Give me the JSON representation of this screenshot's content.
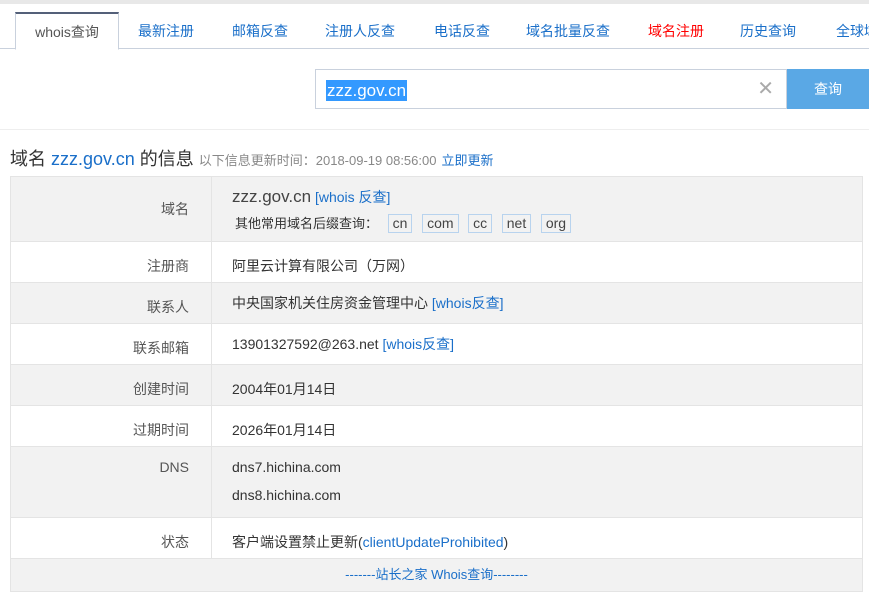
{
  "tabs": [
    {
      "label": "whois查询",
      "active": true
    },
    {
      "label": "最新注册"
    },
    {
      "label": "邮箱反查"
    },
    {
      "label": "注册人反查"
    },
    {
      "label": "电话反查"
    },
    {
      "label": "域名批量反查"
    },
    {
      "label": "域名注册",
      "color": "#ff0000"
    },
    {
      "label": "历史查询"
    },
    {
      "label": "全球域"
    }
  ],
  "search": {
    "value": "zzz.gov.cn",
    "button": "查询",
    "clear_icon": "close-icon"
  },
  "heading": {
    "prefix": "域名",
    "domain": "zzz.gov.cn",
    "suffix": "的信息",
    "update_text": "以下信息更新时间：2018-09-19 08:56:00",
    "update_link": "立即更新"
  },
  "rows": {
    "domain": {
      "label": "域名",
      "value": "zzz.gov.cn",
      "link": "[whois 反查]",
      "suffix_label": "其他常用域名后缀查询：",
      "suffixes": [
        "cn",
        "com",
        "cc",
        "net",
        "org"
      ]
    },
    "registrar": {
      "label": "注册商",
      "value": "阿里云计算有限公司（万网）"
    },
    "contact": {
      "label": "联系人",
      "value": "中央国家机关住房资金管理中心",
      "link": "[whois反查]"
    },
    "email": {
      "label": "联系邮箱",
      "value": "13901327592@263.net",
      "link": "[whois反查]"
    },
    "created": {
      "label": "创建时间",
      "value": "2004年01月14日"
    },
    "expires": {
      "label": "过期时间",
      "value": "2026年01月14日"
    },
    "dns": {
      "label": "DNS",
      "values": [
        "dns7.hichina.com",
        "dns8.hichina.com"
      ]
    },
    "status": {
      "label": "状态",
      "prefix": "客户端设置禁止更新(",
      "code": "clientUpdateProhibited",
      "suffix": ")"
    }
  },
  "footer": "-------站长之家 Whois查询--------",
  "colors": {
    "accent": "#1a6fc9",
    "button": "#5aa8e5",
    "highlight": "#ff0000"
  }
}
